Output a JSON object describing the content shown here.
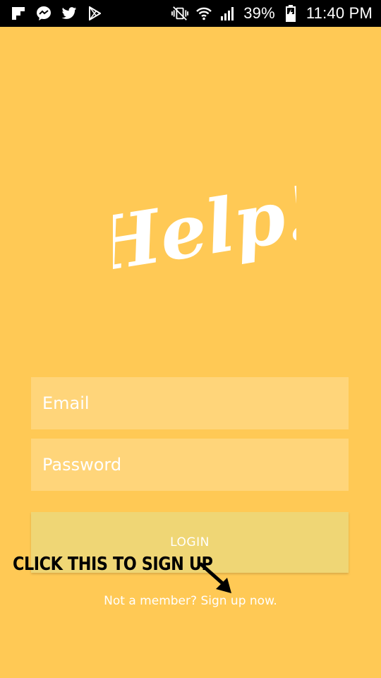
{
  "status_bar": {
    "left_icons": [
      "flipboard-icon",
      "messenger-icon",
      "twitter-icon",
      "play-store-icon"
    ],
    "right_icons": [
      "vibrate-mute-icon",
      "wifi-icon",
      "signal-icon",
      "battery-charging-icon"
    ],
    "battery_percent": "39%",
    "time": "11:40 PM"
  },
  "logo": {
    "text": "Help!"
  },
  "form": {
    "email_placeholder": "Email",
    "password_placeholder": "Password",
    "login_label": "LOGIN"
  },
  "signup": {
    "prompt": "Not a member? ",
    "link": "Sign up now."
  },
  "annotation": {
    "text": "CLICK THIS TO SIGN UP"
  },
  "colors": {
    "background": "#FFC955",
    "field_background": "#FFD57A",
    "button_background": "#EFD675",
    "text": "#FFFFFF",
    "status_bar": "#000000",
    "annotation": "#000000"
  }
}
